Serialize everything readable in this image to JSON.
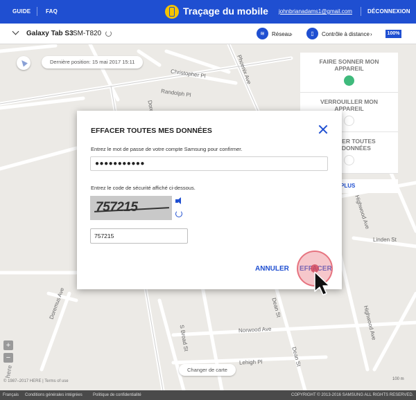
{
  "header": {
    "guide": "GUIDE",
    "faq": "FAQ",
    "title": "Traçage du mobile",
    "email": "johnbrianadams1@gmail.com",
    "logout": "DÉCONNEXION"
  },
  "device": {
    "name": "Galaxy Tab S3",
    "model": "SM-T820",
    "network_label": "Réseau",
    "remote_label": "Contrôle à distance",
    "battery": "100%"
  },
  "map": {
    "last_position": "Dernière position: 15 mai 2017 15:11",
    "change_map": "Changer de carte",
    "copyright": "© 1987–2017 HERE | Terms of use",
    "here_logo": "here",
    "scale": "100 m",
    "streets": {
      "christopher": "Christopher Pl",
      "randolph": "Randolph Pl",
      "phoenix": "Phoenix Ave",
      "doremus": "Doremus Ave",
      "highwood": "Highwood Ave",
      "linden": "Linden St",
      "dean": "Dean St",
      "broad": "S Broad St",
      "norwood": "Norwood Ave",
      "lehigh": "Lehigh Pl"
    },
    "side_panel": {
      "ring": "FAIRE SONNER MON APPAREIL",
      "lock": "VERROUILLER MON APPAREIL",
      "erase": "EFFACER TOUTES MES DONNÉES",
      "more": "PLUS"
    },
    "zoom_in": "+",
    "zoom_out": "−"
  },
  "dialog": {
    "title": "EFFACER TOUTES MES DONNÉES",
    "password_prompt": "Entrez le mot de passe de votre compte Samsung pour confirmer.",
    "password_value": "●●●●●●●●●●●",
    "captcha_prompt": "Entrez le code de sécurité affiché ci-dessous.",
    "captcha_text": "757215",
    "code_value": "757215",
    "cancel": "ANNULER",
    "erase": "EFFACER"
  },
  "footer": {
    "lang": "Français",
    "terms": "Conditions générales intégrées",
    "privacy": "Politique de confidentialité",
    "copyright": "COPYRIGHT © 2013-2016 SAMSUNG ALL RIGHTS RESERVED."
  },
  "colors": {
    "brand_blue": "#1f4fd1",
    "map_bg": "#eceae6"
  }
}
